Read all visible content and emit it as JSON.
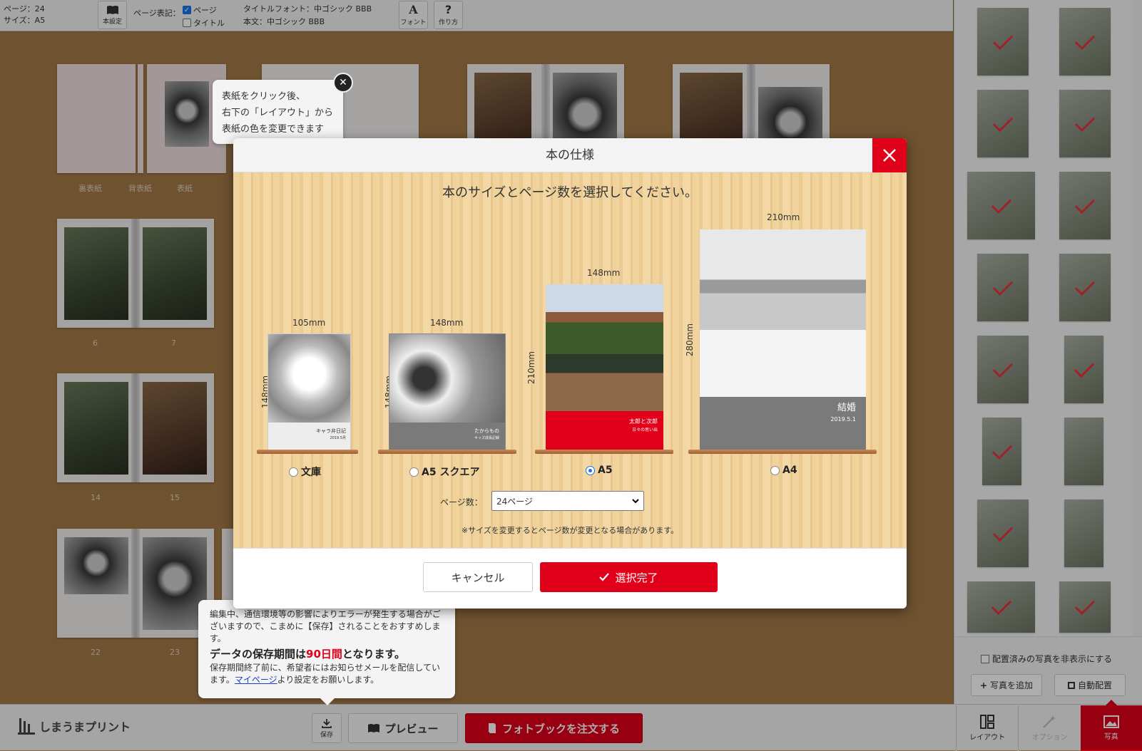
{
  "topbar": {
    "page_info": "ページ：24",
    "size_info": "サイズ：A5",
    "book_settings_label": "本設定",
    "page_label_heading": "ページ表記：",
    "page_checkbox_label": "ページ",
    "title_checkbox_label": "タイトル",
    "title_font": "タイトルフォント：中ゴシック BBB",
    "body_font": "本文：中ゴシック BBB",
    "font_button": "フォント",
    "howto_button": "作り方",
    "font_icon_glyph": "A",
    "howto_icon_glyph": "?"
  },
  "workspace": {
    "cover_labels": [
      "裏表紙",
      "背表紙",
      "表紙"
    ],
    "page_numbers": [
      "6",
      "7",
      "14",
      "15",
      "22",
      "23"
    ]
  },
  "cover_tip": {
    "line1": "表紙をクリック後、",
    "line2": "右下の「レイアウト」から",
    "line3": "表紙の色を変更できます"
  },
  "save_tip": {
    "text1": "編集中、通信環境等の影響によりエラーが発生する場合がございますので、こまめに【保存】されることをおすすめします。",
    "bold_prefix": "データの保存期間は",
    "bold_days": "90日間",
    "bold_suffix": "となります。",
    "text2_prefix": "保存期間終了前に、希望者にはお知らせメールを配信しています。",
    "link": "マイページ",
    "text2_suffix": "より設定をお願いします。"
  },
  "modal": {
    "title": "本の仕様",
    "instruction": "本のサイズとページ数を選択してください。",
    "sizes": [
      {
        "label": "文庫",
        "width": "105mm",
        "height": "148mm",
        "selected": false,
        "cover_title": "キャラ弁日記",
        "cover_sub": "2019.5月"
      },
      {
        "label": "A5 スクエア",
        "width": "148mm",
        "height": "148mm",
        "selected": false,
        "cover_title": "たからもの",
        "cover_sub": "キッズ成長記録"
      },
      {
        "label": "A5",
        "width": "148mm",
        "height": "210mm",
        "selected": true,
        "cover_title": "太郎と次郎",
        "cover_sub": "日々の思い出"
      },
      {
        "label": "A4",
        "width": "210mm",
        "height": "280mm",
        "selected": false,
        "cover_title": "結婚",
        "cover_sub": "2019.5.1"
      }
    ],
    "pages_label": "ページ数：",
    "pages_value": "24ページ",
    "note": "※サイズを変更するとページ数が変更となる場合があります。",
    "cancel": "キャンセル",
    "confirm": "選択完了",
    "accent": "#e0001a"
  },
  "right_panel": {
    "hide_placed_label": "配置済みの写真を非表示にする",
    "add_photo": "写真を追加",
    "auto_place": "自動配置",
    "tabs": [
      "レイアウト",
      "オプション",
      "写真"
    ],
    "active_tab": "写真"
  },
  "bottombar": {
    "logo": "しまうまプリント",
    "save": "保存",
    "preview": "プレビュー",
    "order": "フォトブックを注文する"
  }
}
